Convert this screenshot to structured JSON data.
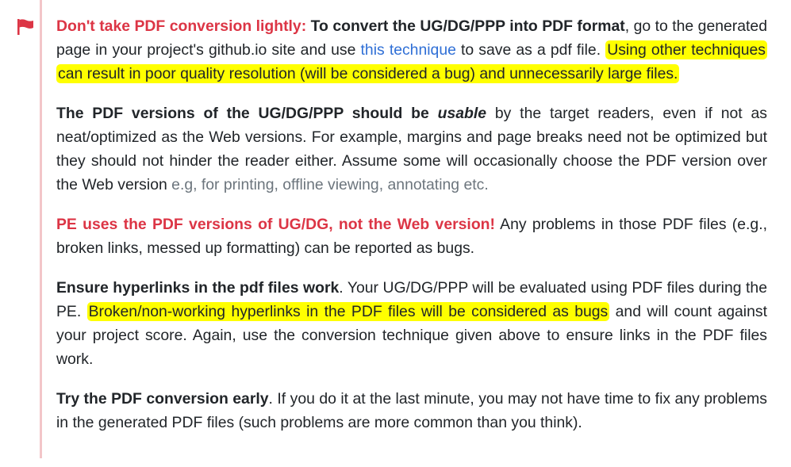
{
  "colors": {
    "accent_red": "#dc3545",
    "highlight": "#ffff00",
    "link": "#2f6fd6",
    "muted": "#6c757d",
    "sidebar_bar": "#f3c6c9"
  },
  "icons": {
    "flag": "flag-icon"
  },
  "p1": {
    "lead": "Don't take PDF conversion lightly:",
    "bold": "To convert the UG/DG/PPP into PDF format",
    "text1": ", go to the generated page in your project's github.io site and use ",
    "link": "this technique",
    "text2": " to save as a pdf file. ",
    "highlight": "Using other techniques can result in poor quality resolution (will be considered a bug) and unnecessarily large files."
  },
  "p2": {
    "bold_a": "The PDF versions of the UG/DG/PPP should be ",
    "bold_em": "usable",
    "text": " by the target readers, even if not as neat/optimized as the Web versions. For example, margins and page breaks need not be optimized but they should not hinder the reader either. Assume some will occasionally choose the PDF version over the Web version ",
    "muted": "e.g, for printing, offline viewing, annotating etc."
  },
  "p3": {
    "lead": "PE uses the PDF versions of UG/DG, not the Web version!",
    "text": " Any problems in those PDF files (e.g., broken links, messed up formatting) can be reported as bugs."
  },
  "p4": {
    "bold": "Ensure hyperlinks in the pdf files work",
    "text1": ". Your UG/DG/PPP will be evaluated using PDF files during the PE. ",
    "highlight": "Broken/non-working hyperlinks in the PDF files will be considered as bugs",
    "text2": " and will count against your project score. Again, use the conversion technique given above to ensure links in the PDF files work."
  },
  "p5": {
    "bold": "Try the PDF conversion early",
    "text": ". If you do it at the last minute, you may not have time to fix any problems in the generated PDF files (such problems are more common than you think)."
  }
}
